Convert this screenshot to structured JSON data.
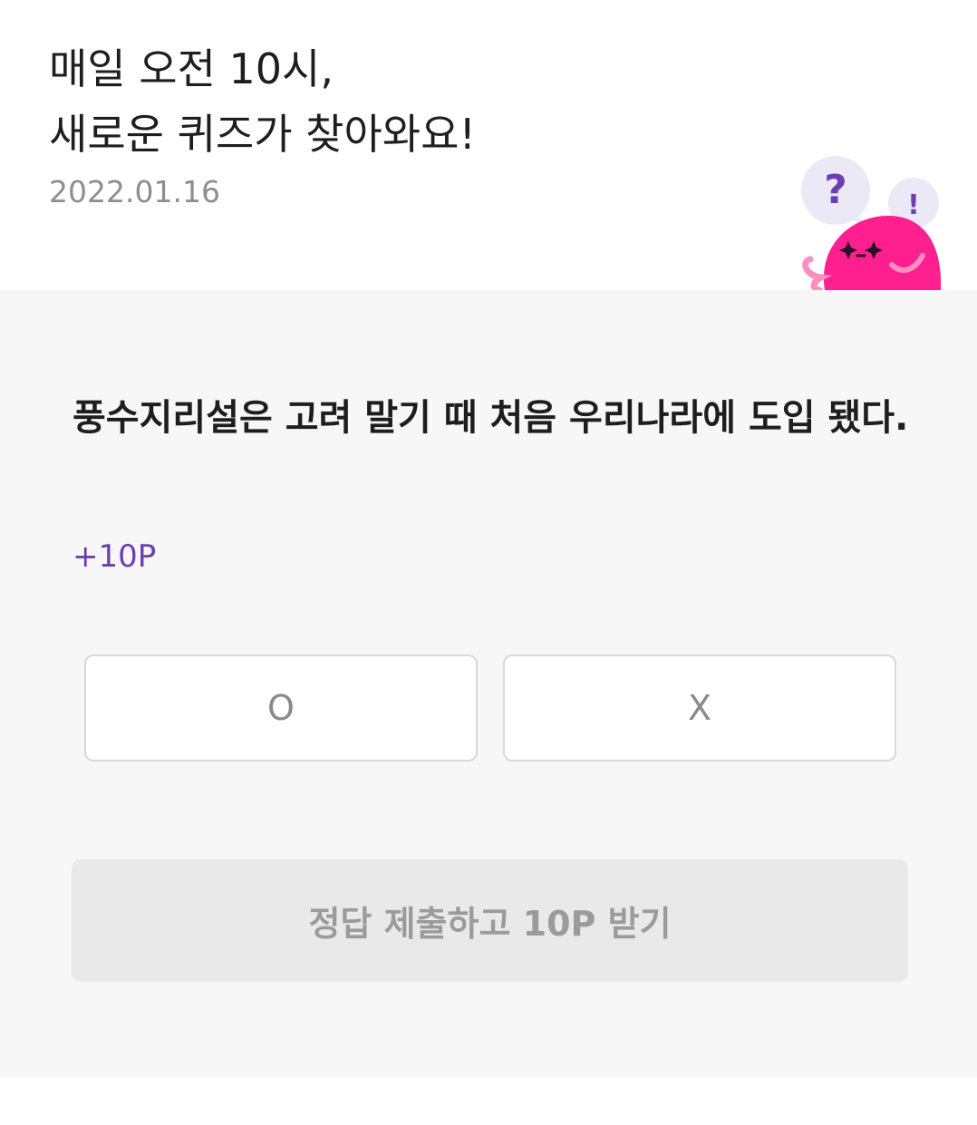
{
  "header": {
    "headline_line1": "매일 오전 10시,",
    "headline_line2": "새로운 퀴즈가 찾아와요!",
    "date": "2022.01.16",
    "mascot_icon": "pink-blob-mascot-icon",
    "question_bubble_text": "?",
    "exclaim_bubble_text": "!"
  },
  "quiz": {
    "question": "풍수지리설은 고려 말기 때 처음 우리나라에 도입 됐다.",
    "points": "+10P",
    "answers": [
      {
        "label": "O"
      },
      {
        "label": "X"
      }
    ],
    "submit_label": "정답 제출하고 10P 받기"
  },
  "colors": {
    "accent_purple": "#6c3fb0",
    "mascot_pink": "#ff1f8e",
    "panel_background": "#f7f7f7",
    "submit_disabled": "#e9e9e9"
  }
}
